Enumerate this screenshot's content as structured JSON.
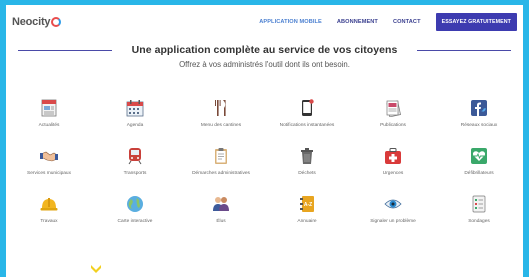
{
  "brand": {
    "name": "Neocity"
  },
  "nav": {
    "links": [
      "APPLICATION MOBILE",
      "ABONNEMENT",
      "CONTACT"
    ],
    "cta": "ESSAYEZ GRATUITEMENT"
  },
  "hero": {
    "title": "Une application complète au service de vos citoyens",
    "subtitle": "Offrez à vos administrés l'outil dont ils ont besoin."
  },
  "features": [
    {
      "label": "Actualités",
      "icon": "newspaper-icon"
    },
    {
      "label": "Agenda",
      "icon": "calendar-icon"
    },
    {
      "label": "Menu des cantines",
      "icon": "cutlery-icon"
    },
    {
      "label": "Notifications instantanées",
      "icon": "phone-notification-icon"
    },
    {
      "label": "Publications",
      "icon": "publications-icon"
    },
    {
      "label": "Réseaux sociaux",
      "icon": "facebook-twitter-icon"
    },
    {
      "label": "Services municipaux",
      "icon": "handshake-icon"
    },
    {
      "label": "Transports",
      "icon": "train-icon"
    },
    {
      "label": "Démarches administratives",
      "icon": "clipboard-icon"
    },
    {
      "label": "Déchets",
      "icon": "trash-icon"
    },
    {
      "label": "Urgences",
      "icon": "first-aid-icon"
    },
    {
      "label": "Défibrillateurs",
      "icon": "heart-monitor-icon"
    },
    {
      "label": "Travaux",
      "icon": "hard-hat-icon"
    },
    {
      "label": "Carte interactive",
      "icon": "globe-map-icon"
    },
    {
      "label": "Élus",
      "icon": "people-icon"
    },
    {
      "label": "Annuaire",
      "icon": "address-book-icon"
    },
    {
      "label": "Signaler un problème",
      "icon": "eye-icon"
    },
    {
      "label": "Sondages",
      "icon": "checklist-icon"
    }
  ],
  "colors": {
    "frame": "#29b6e8",
    "accent": "#3d3bb0",
    "nav_text": "#3a3f8f"
  }
}
